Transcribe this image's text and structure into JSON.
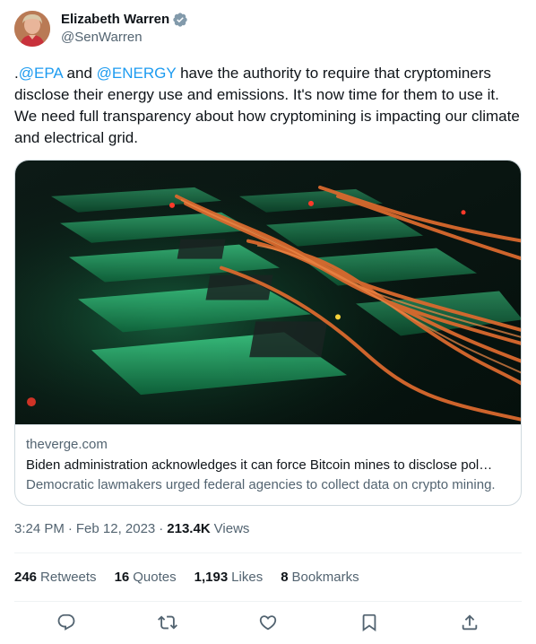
{
  "author": {
    "display_name": "Elizabeth Warren",
    "handle": "@SenWarren",
    "verified": true
  },
  "tweet": {
    "prefix": ".",
    "mention1": "@EPA",
    "and": " and ",
    "mention2": "@ENERGY",
    "body": " have the authority to require that cryptominers disclose their energy use and emissions. It's now time for them to use it. We need full transparency about how cryptomining is impacting our climate and electrical grid."
  },
  "card": {
    "domain": "theverge.com",
    "title": "Biden administration acknowledges it can force Bitcoin mines to disclose pol…",
    "description": "Democratic lawmakers urged federal agencies to collect data on crypto mining."
  },
  "meta": {
    "time": "3:24 PM",
    "separator": "·",
    "date": "Feb 12, 2023",
    "views_count": "213.4K",
    "views_label": "Views"
  },
  "stats": {
    "retweets_count": "246",
    "retweets_label": "Retweets",
    "quotes_count": "16",
    "quotes_label": "Quotes",
    "likes_count": "1,193",
    "likes_label": "Likes",
    "bookmarks_count": "8",
    "bookmarks_label": "Bookmarks"
  },
  "actions": {
    "reply_icon": "reply-icon",
    "retweet_icon": "retweet-icon",
    "like_icon": "like-icon",
    "bookmark_icon": "bookmark-icon",
    "share_icon": "share-icon"
  },
  "colors": {
    "link": "#1d9bf0",
    "secondary_text": "#536471",
    "primary_text": "#0f1419",
    "verified_badge": "#829aab"
  }
}
